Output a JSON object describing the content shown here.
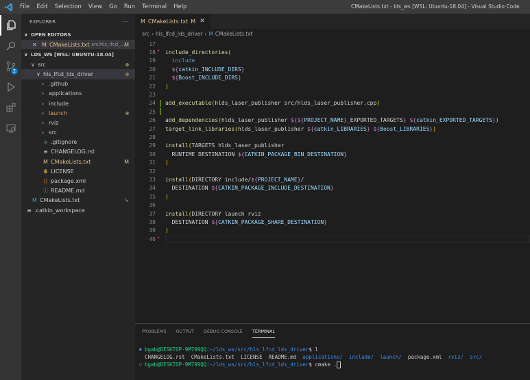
{
  "titlebar": {
    "menu": [
      "File",
      "Edit",
      "Selection",
      "View",
      "Go",
      "Run",
      "Terminal",
      "Help"
    ],
    "window_title": "CMakeLists.txt - lds_ws [WSL: Ubuntu-18.04] - Visual Studio Code"
  },
  "activity": {
    "items": [
      "explorer-icon",
      "search-icon",
      "source-control-icon",
      "run-debug-icon",
      "extensions-icon",
      "remote-explorer-icon"
    ],
    "scm_badge": "2"
  },
  "sidebar": {
    "header": "EXPLORER",
    "more": "···",
    "open_editors_label": "OPEN EDITORS",
    "open_editor": {
      "close": "✕",
      "icon": "M",
      "name": "CMakeLists.txt",
      "path": "src/hls_lfcd_...",
      "mark": "M"
    },
    "workspace_label": "LDS_WS [WSL: UBUNTU-18.04]",
    "tree": [
      {
        "label": "src",
        "chev": "∨",
        "icon": "",
        "indent": 8,
        "dot": true
      },
      {
        "label": "hls_lfcd_lds_driver",
        "chev": "∨",
        "icon": "",
        "indent": 16,
        "dot": true,
        "sel": true
      },
      {
        "label": ".github",
        "chev": "›",
        "icon": "",
        "indent": 24
      },
      {
        "label": "applications",
        "chev": "›",
        "icon": "",
        "indent": 24
      },
      {
        "label": "include",
        "chev": "›",
        "icon": "",
        "indent": 24
      },
      {
        "label": "launch",
        "chev": "›",
        "icon": "",
        "indent": 24,
        "dot": true,
        "orange": true
      },
      {
        "label": "rviz",
        "chev": "›",
        "icon": "",
        "indent": 24
      },
      {
        "label": "src",
        "chev": "›",
        "icon": "",
        "indent": 24
      },
      {
        "label": ".gitignore",
        "chev": "",
        "icon": "◆",
        "indent": 24
      },
      {
        "label": "CHANGELOG.rst",
        "chev": "",
        "icon": "≡",
        "indent": 24
      },
      {
        "label": "CMakeLists.txt",
        "chev": "",
        "icon": "M",
        "indent": 24,
        "mark": "M",
        "mod": true
      },
      {
        "label": "LICENSE",
        "chev": "",
        "icon": "♛",
        "indent": 24
      },
      {
        "label": "package.xml",
        "chev": "",
        "icon": "⟨⟩",
        "indent": 24
      },
      {
        "label": "README.md",
        "chev": "",
        "icon": "ⓘ",
        "indent": 24
      },
      {
        "label": "CMakeLists.txt",
        "chev": "",
        "icon": "M",
        "indent": 8,
        "mark": "↳"
      },
      {
        "label": ".catkin_workspace",
        "chev": "",
        "icon": "≡",
        "indent": 0
      }
    ]
  },
  "editor": {
    "tab": {
      "icon": "M",
      "label": "CMakeLists.txt",
      "mark": "M",
      "close": "✕"
    },
    "breadcrumb": [
      "src",
      "hls_lfcd_lds_driver",
      "CMakeLists.txt"
    ],
    "lines": [
      {
        "n": "17",
        "html": ""
      },
      {
        "n": "18",
        "html": "<span class='f'>include_directories</span><span class='p'>(</span>"
      },
      {
        "n": "19",
        "html": "  <span class='s'>include</span>"
      },
      {
        "n": "20",
        "html": "  <span class='v'>${</span><span class='k'>catkin_INCLUDE_DIRS</span><span class='v'>}</span>"
      },
      {
        "n": "21",
        "html": "  <span class='v'>${</span><span class='k'>Boost_INCLUDE_DIRS</span><span class='v'>}</span>"
      },
      {
        "n": "22",
        "html": "<span class='p'>)</span>"
      },
      {
        "n": "23",
        "html": ""
      },
      {
        "n": "24",
        "html": "<span class='f'>add_executable</span><span class='p'>(</span><span class='w'>hlds_laser_publisher src/hlds_laser_publisher.cpp</span><span class='p'>)</span>"
      },
      {
        "n": "25",
        "html": ""
      },
      {
        "n": "26",
        "html": "<span class='f'>add_dependencies</span><span class='p'>(</span><span class='w'>hlds_laser_publisher </span><span class='v'>${${</span><span class='k'>PROJECT_NAME</span><span class='v'>}</span><span class='w'>_EXPORTED_TARGETS</span><span class='v'>}</span><span class='w'> </span><span class='v'>${</span><span class='k'>catkin_EXPORTED_TARGETS</span><span class='v'>}</span><span class='p'>)</span>"
      },
      {
        "n": "27",
        "html": "<span class='f'>target_link_libraries</span><span class='p'>(</span><span class='w'>hlds_laser_publisher </span><span class='v'>${</span><span class='k'>catkin_LIBRARIES</span><span class='v'>}</span><span class='w'> </span><span class='v'>${</span><span class='k'>Boost_LIBRARIES</span><span class='v'>}</span><span class='p'>)</span>"
      },
      {
        "n": "28",
        "html": ""
      },
      {
        "n": "29",
        "html": "<span class='f'>install</span><span class='p'>(</span><span class='w'>TARGETS hlds_laser_publisher</span>"
      },
      {
        "n": "30",
        "html": "  <span class='w'>RUNTIME DESTINATION </span><span class='v'>${</span><span class='k'>CATKIN_PACKAGE_BIN_DESTINATION</span><span class='v'>}</span>"
      },
      {
        "n": "31",
        "html": "<span class='p'>)</span>"
      },
      {
        "n": "32",
        "html": ""
      },
      {
        "n": "33",
        "html": "<span class='f'>install</span><span class='p'>(</span><span class='w'>DIRECTORY include/</span><span class='v'>${</span><span class='k'>PROJECT_NAME</span><span class='v'>}</span><span class='w'>/</span>"
      },
      {
        "n": "34",
        "html": "  <span class='w'>DESTINATION </span><span class='v'>${</span><span class='k'>CATKIN_PACKAGE_INCLUDE_DESTINATION</span><span class='v'>}</span>"
      },
      {
        "n": "35",
        "html": "<span class='p'>)</span>"
      },
      {
        "n": "36",
        "html": ""
      },
      {
        "n": "37",
        "html": "<span class='f'>install</span><span class='p'>(</span><span class='w'>DIRECTORY launch rviz</span>"
      },
      {
        "n": "38",
        "html": "  <span class='w'>DESTINATION </span><span class='v'>${</span><span class='k'>CATKIN_PACKAGE_SHARE_DESTINATION</span><span class='v'>}</span>"
      },
      {
        "n": "39",
        "html": "<span class='p'>)</span>"
      },
      {
        "n": "40",
        "html": ""
      }
    ]
  },
  "panel": {
    "tabs": [
      "PROBLEMS",
      "OUTPUT",
      "DEBUG CONSOLE",
      "TERMINAL"
    ],
    "active_tab": "TERMINAL",
    "terminal": {
      "prompt_user": "bgab@DESKTOP-9M709QQ",
      "prompt_path": ":~/lds_ws/src/hls_lfcd_lds_driver",
      "cmd1": "$ l",
      "ls_files": "CHANGELOG.rst  CMakeLists.txt  LICENSE  README.md  ",
      "ls_dirs": [
        "applications/",
        "include/",
        "launch/"
      ],
      "ls_file2": "package.xml",
      "ls_dirs2": [
        "rviz/",
        "src/"
      ],
      "cmd2": "$ cmake ."
    }
  }
}
